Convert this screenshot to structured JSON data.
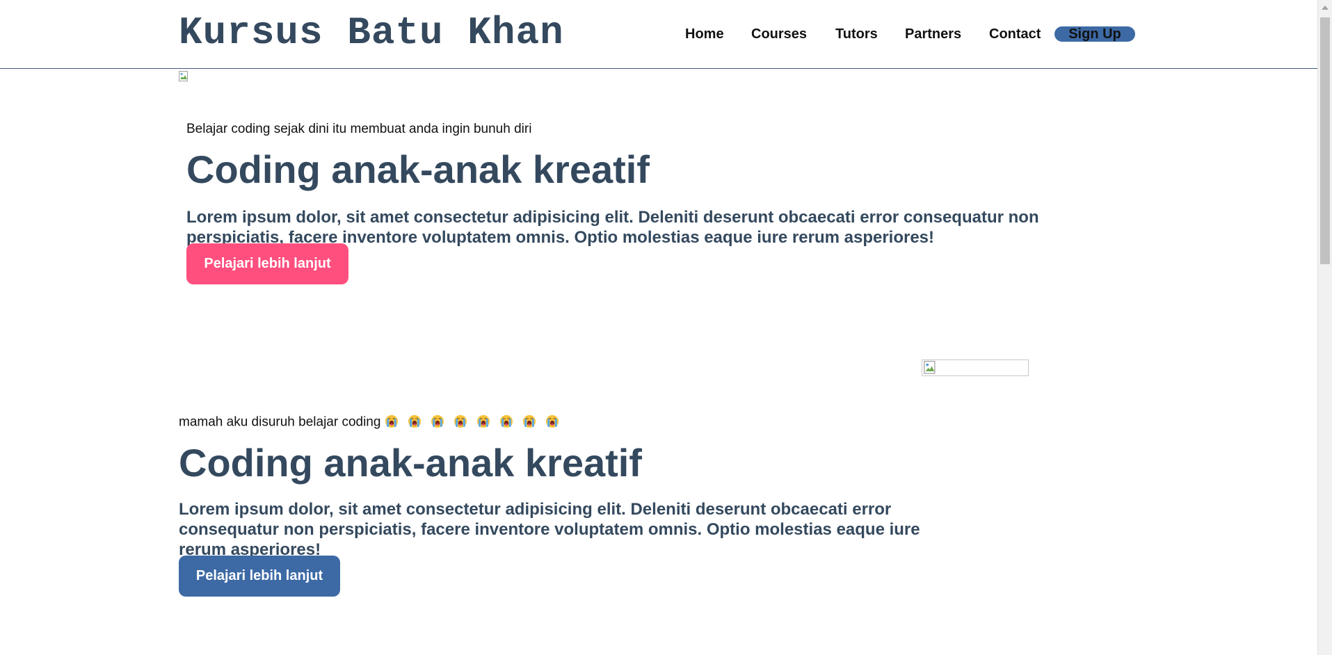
{
  "header": {
    "brand": "Kursus Batu Khan",
    "nav": [
      "Home",
      "Courses",
      "Tutors",
      "Partners",
      "Contact"
    ],
    "signup_label": "Sign Up"
  },
  "hero1": {
    "eyebrow": "Belajar coding sejak dini itu membuat anda ingin bunuh diri",
    "headline": "Coding anak-anak kreatif",
    "lead": "Lorem ipsum dolor, sit amet consectetur adipisicing elit. Deleniti deserunt obcaecati error consequatur non perspiciatis, facere inventore voluptatem omnis. Optio molestias eaque iure rerum asperiores!",
    "cta_label": "Pelajari lebih lanjut",
    "cta_color": "#ff4f7e"
  },
  "hero2": {
    "eyebrow": "mamah aku disuruh belajar coding",
    "eyebrow_emoji": "loudly-crying-face-icon",
    "emoji_count": 8,
    "headline": "Coding anak-anak kreatif",
    "lead": "Lorem ipsum dolor, sit amet consectetur adipisicing elit. Deleniti deserunt obcaecati error consequatur non perspiciatis, facere inventore voluptatem omnis. Optio molestias eaque iure rerum asperiores!",
    "cta_label": "Pelajari lebih lanjut",
    "cta_color": "#3d6aa5"
  },
  "colors": {
    "heading": "#34495e",
    "accent_blue": "#3d6aa5",
    "accent_pink": "#ff4f7e",
    "text": "#111111"
  }
}
